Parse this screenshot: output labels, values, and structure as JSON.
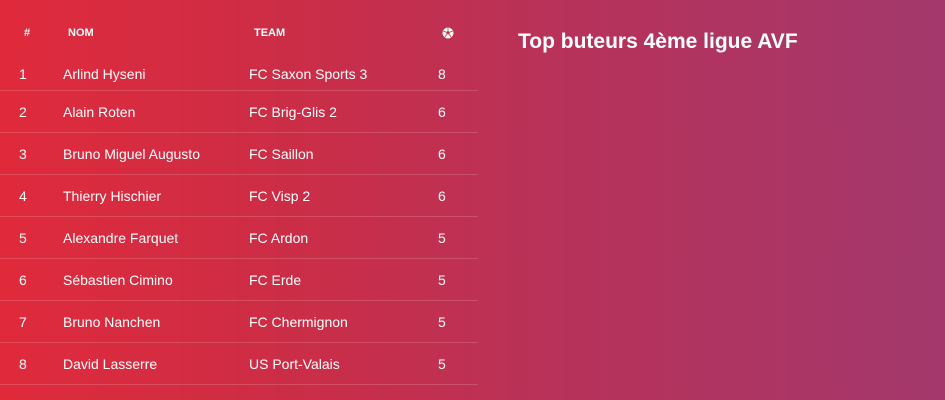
{
  "title": "Top buteurs 4ème ligue AVF",
  "table": {
    "headers": {
      "rank": "#",
      "name": "NOM",
      "team": "TEAM",
      "goals_icon": "soccer-ball-icon"
    },
    "rows": [
      {
        "rank": "1",
        "name": "Arlind Hyseni",
        "team": "FC Saxon Sports 3",
        "goals": "8"
      },
      {
        "rank": "2",
        "name": "Alain Roten",
        "team": "FC Brig-Glis 2",
        "goals": "6"
      },
      {
        "rank": "3",
        "name": "Bruno Miguel Augusto",
        "team": "FC Saillon",
        "goals": "6"
      },
      {
        "rank": "4",
        "name": "Thierry Hischier",
        "team": "FC Visp 2",
        "goals": "6"
      },
      {
        "rank": "5",
        "name": "Alexandre Farquet",
        "team": "FC Ardon",
        "goals": "5"
      },
      {
        "rank": "6",
        "name": "Sébastien Cimino",
        "team": "FC Erde",
        "goals": "5"
      },
      {
        "rank": "7",
        "name": "Bruno Nanchen",
        "team": "FC Chermignon",
        "goals": "5"
      },
      {
        "rank": "8",
        "name": "David Lasserre",
        "team": "US Port-Valais",
        "goals": "5"
      }
    ]
  },
  "colors": {
    "gradient_start": "#e02a3c",
    "gradient_end": "#a3386c",
    "text": "#ffffff"
  }
}
